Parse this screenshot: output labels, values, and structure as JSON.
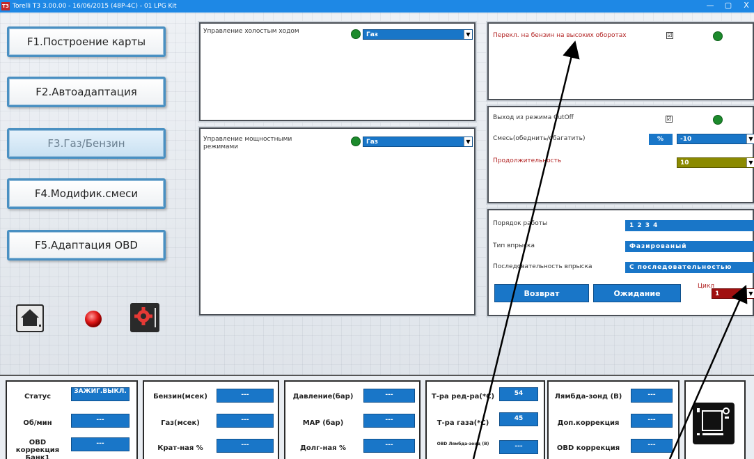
{
  "window": {
    "title": "Torelli T3 3.00.00 - 16/06/2015 (48P-4C) - 01 LPG Kit",
    "app_icon": "T3",
    "minimize": "—",
    "maximize": "▢",
    "close": "X"
  },
  "nav": [
    {
      "label": "F1.Построение карты"
    },
    {
      "label": "F2.Автоадаптация"
    },
    {
      "label": "F3.Газ/Бензин"
    },
    {
      "label": "F4.Модифик.смеси"
    },
    {
      "label": "F5.Адаптация OBD"
    }
  ],
  "idle": {
    "label": "Управление холостым ходом",
    "value": "Газ"
  },
  "power": {
    "label": "Управление мощностными режимами",
    "value": "Газ"
  },
  "high_rpm": {
    "label": "Перекл. на бензин на высоких оборотах",
    "check": "☑"
  },
  "cutoff": {
    "label": "Выход из режима CutOff",
    "check": "☑",
    "mix_label": "Смесь(обеднить/обагатить)",
    "percent": "%",
    "mix_value": "-10",
    "duration_label": "Продолжительность",
    "duration_value": "10"
  },
  "sequence": {
    "order_label": "Порядок работы",
    "order_value": "1 2 3 4",
    "type_label": "Тип впрыска",
    "type_value": "Фазированый",
    "seq_label": "Последовательность впрыска",
    "seq_value": "С последовательностью",
    "back_button": "Возврат",
    "wait_button": "Ожидание",
    "cycle_label": "Цикл",
    "cycle_value": "1"
  },
  "status": {
    "col1": [
      {
        "label": "Статус",
        "value": "ЗАЖИГ.ВЫКЛ."
      },
      {
        "label": "Об/мин",
        "value": "---"
      },
      {
        "label": "OBD коррекция Банк1",
        "value": "---"
      }
    ],
    "col2": [
      {
        "label": "Бензин(мсек)",
        "value": "---"
      },
      {
        "label": "Газ(мсек)",
        "value": "---"
      },
      {
        "label": "Крат-ная %",
        "value": "---"
      }
    ],
    "col3": [
      {
        "label": "Давление(бар)",
        "value": "---"
      },
      {
        "label": "MAP (бар)",
        "value": "---"
      },
      {
        "label": "Долг-ная %",
        "value": "---"
      }
    ],
    "col4": [
      {
        "label": "Т-ра ред-ра(*С)",
        "value": "54"
      },
      {
        "label": "Т-ра газа(*С)",
        "value": "45"
      },
      {
        "label": "OBD Лямбда-зонд (В)",
        "value": "---"
      }
    ],
    "col5": [
      {
        "label": "Лямбда-зонд (В)",
        "value": "---"
      },
      {
        "label": "Доп.коррекция",
        "value": "---"
      },
      {
        "label": "OBD коррекция",
        "value": "---"
      }
    ]
  },
  "colors": {
    "accent": "#1976c8",
    "titlebar": "#1e88e5",
    "indicator_green": "#1c8a2c",
    "indicator_red": "#e01818",
    "duration_olive": "#8b8a00",
    "cycle_red": "#a01010"
  }
}
